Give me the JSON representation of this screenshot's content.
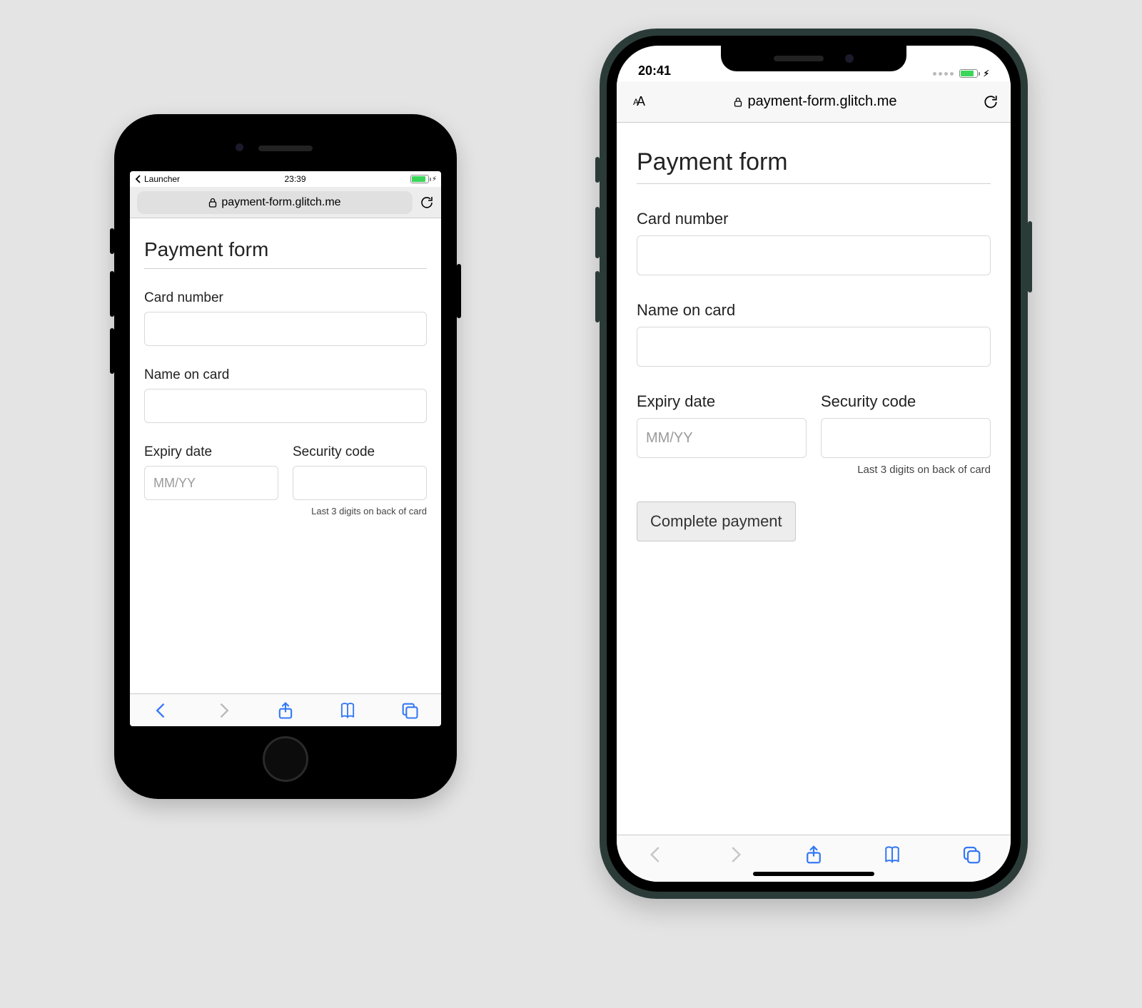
{
  "left": {
    "status": {
      "back_label": "Launcher",
      "time": "23:39"
    },
    "addressbar": {
      "url": "payment-form.glitch.me"
    },
    "page": {
      "title": "Payment form",
      "card_number_label": "Card number",
      "name_label": "Name on card",
      "expiry_label": "Expiry date",
      "expiry_placeholder": "MM/YY",
      "cvc_label": "Security code",
      "cvc_helper": "Last 3 digits on back of card"
    }
  },
  "right": {
    "status": {
      "time": "20:41"
    },
    "addressbar": {
      "aa_label": "aA",
      "url": "payment-form.glitch.me"
    },
    "page": {
      "title": "Payment form",
      "card_number_label": "Card number",
      "name_label": "Name on card",
      "expiry_label": "Expiry date",
      "expiry_placeholder": "MM/YY",
      "cvc_label": "Security code",
      "cvc_helper": "Last 3 digits on back of card",
      "submit_label": "Complete payment"
    }
  }
}
